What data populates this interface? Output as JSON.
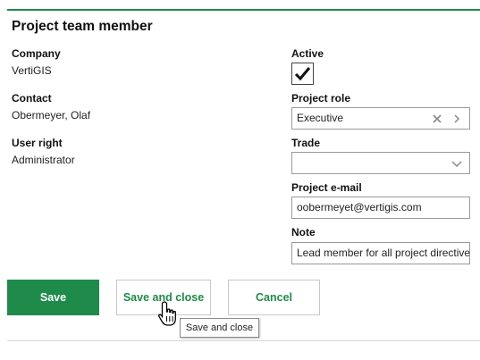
{
  "title": "Project team member",
  "left": {
    "company_label": "Company",
    "company_value": "VertiGIS",
    "contact_label": "Contact",
    "contact_value": "Obermeyer, Olaf",
    "user_right_label": "User right",
    "user_right_value": "Administrator"
  },
  "right": {
    "active_label": "Active",
    "active_checked": true,
    "role_label": "Project role",
    "role_value": "Executive",
    "trade_label": "Trade",
    "trade_value": "",
    "email_label": "Project e-mail",
    "email_value": "oobermeyet@vertigis.com",
    "note_label": "Note",
    "note_value": "Lead member for all project directives"
  },
  "buttons": {
    "save": "Save",
    "save_close": "Save and close",
    "cancel": "Cancel"
  },
  "tooltip": "Save and close",
  "colors": {
    "accent": "#1e8b4a",
    "border": "#9a9a9a"
  },
  "icons": {
    "clear": "clear-x-icon",
    "chevron_right": "chevron-right-icon",
    "chevron_down": "chevron-down-icon",
    "check": "check-icon",
    "cursor": "hand-pointer-icon"
  }
}
